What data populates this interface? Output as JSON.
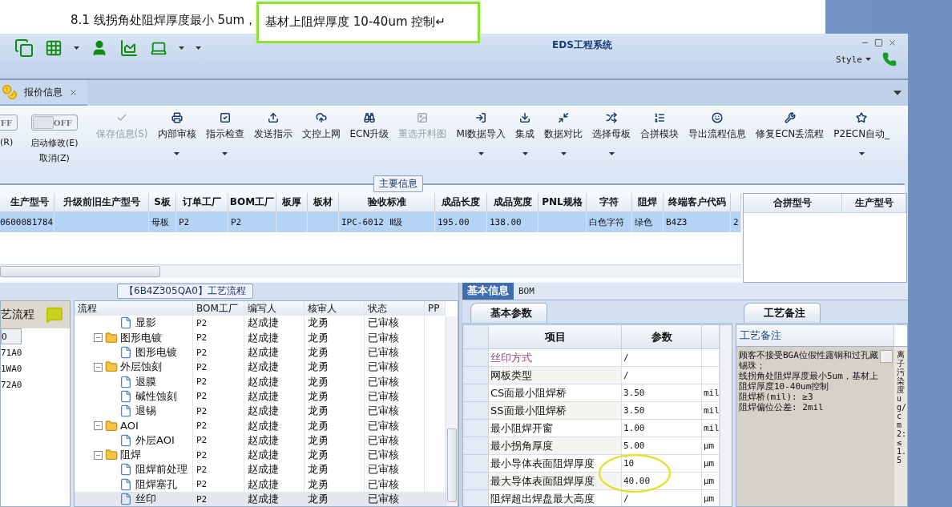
{
  "document": {
    "text": "8.1 线拐角处阻焊厚度最小 5um，",
    "highlighted_text": "基材上阻焊厚度 10-40um 控制↵"
  },
  "window": {
    "title": "EDS工程系统",
    "style_menu": "Style"
  },
  "tabs": [
    {
      "label": "报价信息",
      "selected": true
    }
  ],
  "ribbon": {
    "toggles": [
      {
        "switch_label": "FF",
        "on": false,
        "captions": [
          "(R)"
        ]
      },
      {
        "switch_label": "OFF",
        "on": false,
        "captions": [
          "启动修改(E)",
          "取消(Z)"
        ]
      }
    ],
    "buttons": [
      {
        "label": "保存信息(S)",
        "disabled": true,
        "dropdown": false
      },
      {
        "label": "内部审核",
        "disabled": false,
        "dropdown": true
      },
      {
        "label": "指示检查",
        "disabled": false,
        "dropdown": true
      },
      {
        "label": "发送指示",
        "disabled": false,
        "dropdown": false
      },
      {
        "label": "文控上网",
        "disabled": false,
        "dropdown": false
      },
      {
        "label": "ECN升级",
        "disabled": false,
        "dropdown": false
      },
      {
        "label": "重选开料图",
        "disabled": true,
        "dropdown": false
      },
      {
        "label": "MI数据导入",
        "disabled": false,
        "dropdown": true
      },
      {
        "label": "集成",
        "disabled": false,
        "dropdown": true
      },
      {
        "label": "数据对比",
        "disabled": false,
        "dropdown": true
      },
      {
        "label": "选择母板",
        "disabled": false,
        "dropdown": true
      },
      {
        "label": "合拼模块",
        "disabled": false,
        "dropdown": false
      },
      {
        "label": "导出流程信息",
        "disabled": false,
        "dropdown": false
      },
      {
        "label": "修复ECN丢流程",
        "disabled": false,
        "dropdown": false
      },
      {
        "label": "P2ECN自动_",
        "disabled": false,
        "dropdown": true
      }
    ]
  },
  "main_info": {
    "group_label": "主要信息",
    "columns": [
      "生产型号",
      "升级前旧生产型号",
      "S板",
      "订单工厂",
      "BOM工厂",
      "板厚",
      "板材",
      "验收标准",
      "成品长度",
      "成品宽度",
      "PNL规格",
      "字符",
      "阻焊",
      "终端客户代码"
    ],
    "rows": [
      {
        "selected": true,
        "cells": [
          "0600081784",
          null,
          "母板",
          "P2",
          "P2",
          null,
          null,
          "IPC-6012 Ⅱ级",
          "195.00",
          "138.00",
          null,
          "白色字符",
          "绿色",
          "B4Z3",
          "2"
        ]
      }
    ]
  },
  "merge_table": {
    "columns": [
      "合拼型号",
      "生产型号"
    ]
  },
  "flow_list": {
    "title": "艺流程",
    "items": [
      {
        "label": "O",
        "selected": true
      },
      {
        "label": "71A0",
        "selected": false
      },
      {
        "label": "1WA0",
        "selected": false
      },
      {
        "label": "72A0",
        "selected": false
      }
    ]
  },
  "flow": {
    "group_label": "【6B4Z305QA0】工艺流程",
    "tree_column": "流程",
    "columns": [
      "BOM工厂",
      "编写人",
      "核审人",
      "状态",
      "PP"
    ],
    "rows": [
      {
        "kind": "file",
        "label": "显影",
        "selected": false,
        "cells": [
          "P2",
          "赵成捷",
          "龙勇",
          "已审核"
        ]
      },
      {
        "kind": "folder",
        "label": "图形电镀",
        "expanded": true,
        "selected": false,
        "cells": [
          "P2",
          "赵成捷",
          "龙勇",
          "已审核"
        ],
        "children": [
          {
            "kind": "file",
            "label": "图形电镀",
            "selected": false,
            "cells": [
              "P2",
              "赵成捷",
              "龙勇",
              "已审核"
            ]
          }
        ]
      },
      {
        "kind": "folder",
        "label": "外层蚀刻",
        "expanded": true,
        "selected": false,
        "cells": [
          "P2",
          "赵成捷",
          "龙勇",
          "已审核"
        ],
        "children": [
          {
            "kind": "file",
            "label": "退膜",
            "selected": false,
            "cells": [
              "P2",
              "赵成捷",
              "龙勇",
              "已审核"
            ]
          },
          {
            "kind": "file",
            "label": "碱性蚀刻",
            "selected": false,
            "cells": [
              "P2",
              "赵成捷",
              "龙勇",
              "已审核"
            ]
          },
          {
            "kind": "file",
            "label": "退锡",
            "selected": false,
            "cells": [
              "P2",
              "赵成捷",
              "龙勇",
              "已审核"
            ]
          }
        ]
      },
      {
        "kind": "folder",
        "label": "AOI",
        "expanded": true,
        "selected": false,
        "cells": [
          "P2",
          "赵成捷",
          "龙勇",
          "已审核"
        ],
        "children": [
          {
            "kind": "file",
            "label": "外层AOI",
            "selected": false,
            "cells": [
              "P2",
              "赵成捷",
              "龙勇",
              "已审核"
            ]
          }
        ]
      },
      {
        "kind": "folder",
        "label": "阻焊",
        "expanded": true,
        "selected": false,
        "cells": [
          "P2",
          "赵成捷",
          "龙勇",
          "已审核"
        ],
        "children": [
          {
            "kind": "file",
            "label": "阻焊前处理",
            "selected": false,
            "cells": [
              "P2",
              "赵成捷",
              "龙勇",
              "已审核"
            ]
          },
          {
            "kind": "file",
            "label": "阻焊塞孔",
            "selected": false,
            "cells": [
              "P2",
              "赵成捷",
              "龙勇",
              "已审核"
            ]
          },
          {
            "kind": "file",
            "label": "丝印",
            "selected": true,
            "cells": [
              "P2",
              "赵成捷",
              "龙勇",
              "已审核"
            ]
          }
        ]
      }
    ]
  },
  "detail_tabs": [
    {
      "label": "基本信息",
      "selected": true
    },
    {
      "label": "BOM",
      "selected": false
    }
  ],
  "params": {
    "tab": "基本参数",
    "columns": [
      "项目",
      "参数"
    ],
    "rows": [
      {
        "item": "丝印方式",
        "value": "/",
        "selected": true
      },
      {
        "item": "网板类型",
        "value": "/",
        "selected": false
      },
      {
        "item": "CS面最小阻焊桥",
        "value": "3.50",
        "unit": "mil",
        "selected": false
      },
      {
        "item": "SS面最小阻焊桥",
        "value": "3.50",
        "unit": "mil",
        "selected": false
      },
      {
        "item": "最小阻焊开窗",
        "value": "1.00",
        "unit": "mil",
        "selected": false
      },
      {
        "item": "最小拐角厚度",
        "value": "5.00",
        "unit": "μm",
        "selected": false
      },
      {
        "item": "最小导体表面阻焊厚度",
        "value": "10",
        "unit": "μm",
        "selected": false
      },
      {
        "item": "最大导体表面阻焊厚度",
        "value": "40.00",
        "unit": "μm",
        "selected": false
      },
      {
        "item": "阻焊超出焊盘最大高度",
        "value": "/",
        "unit": "μm",
        "selected": false
      }
    ]
  },
  "notes": {
    "tab": "工艺备注",
    "header": "工艺备注",
    "lines": [
      "顾客不接受BGA位假性露铜和过孔藏锡珠；",
      "线拐角处阻焊厚度最小5um，基材上阻焊厚度10-40um控制",
      "阻焊桥(mil): ≥3",
      "阻焊偏位公差: 2mil"
    ],
    "side_text": "离子污染度ug/cm2:≤1.5"
  }
}
